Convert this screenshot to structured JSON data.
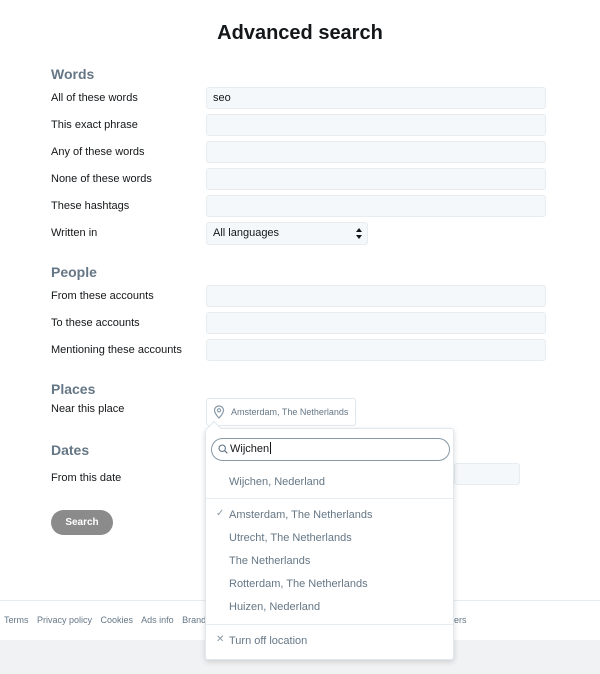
{
  "title": "Advanced search",
  "words": {
    "heading": "Words",
    "rows": [
      {
        "label": "All of these words",
        "value": "seo"
      },
      {
        "label": "This exact phrase",
        "value": ""
      },
      {
        "label": "Any of these words",
        "value": ""
      },
      {
        "label": "None of these words",
        "value": ""
      },
      {
        "label": "These hashtags",
        "value": ""
      }
    ],
    "language_label": "Written in",
    "language_value": "All languages"
  },
  "people": {
    "heading": "People",
    "rows": [
      {
        "label": "From these accounts",
        "value": ""
      },
      {
        "label": "To these accounts",
        "value": ""
      },
      {
        "label": "Mentioning these accounts",
        "value": ""
      }
    ]
  },
  "places": {
    "heading": "Places",
    "label": "Near this place",
    "selected": "Amsterdam, The Netherlands"
  },
  "dates": {
    "heading": "Dates",
    "label": "From this date"
  },
  "search_button": "Search",
  "location_dropdown": {
    "query": "Wijchen",
    "result": "Wijchen, Nederland",
    "recent": [
      "Amsterdam, The Netherlands",
      "Utrecht, The Netherlands",
      "The Netherlands",
      "Rotterdam, The Netherlands",
      "Huizen, Nederland"
    ],
    "checked_index": 0,
    "turn_off": "Turn off location"
  },
  "footer": {
    "links": [
      "Terms",
      "Privacy policy",
      "Cookies",
      "Ads info",
      "Brand"
    ],
    "partial_right": "ers"
  },
  "icons": {
    "select": "updown-arrows-icon",
    "place": "location-pin-icon",
    "search": "magnifier-icon",
    "check": "checkmark-icon",
    "close": "x-icon"
  }
}
